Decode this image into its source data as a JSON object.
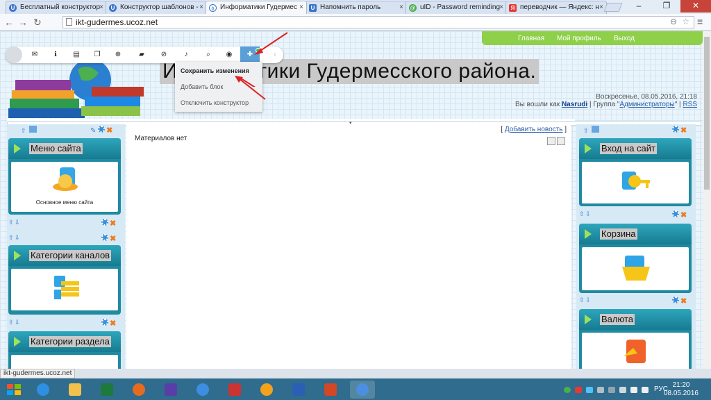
{
  "browser": {
    "tabs": [
      {
        "label": "Бесплатный конструктор"
      },
      {
        "label": "Конструктор шаблонов -"
      },
      {
        "label": "Информатики Гудермес"
      },
      {
        "label": "Напомнить пароль"
      },
      {
        "label": "uID - Password reminding"
      },
      {
        "label": "переводчик — Яндекс: н"
      }
    ],
    "url": "ikt-gudermes.ucoz.net"
  },
  "site": {
    "nav": {
      "home": "Главная",
      "profile": "Мой профиль",
      "logout": "Выход"
    },
    "title": "Информатики Гудермесского района.",
    "date": "Воскресенье, 08.05.2016, 21:18",
    "login_prefix": "Вы вошли как",
    "login_user": "Nasrudi",
    "group_prefix": "| Группа \"",
    "group": "Администраторы",
    "group_suffix": "\" |",
    "rss": "RSS"
  },
  "toolbar": {
    "menu": [
      "Сохранить изменения",
      "Добавить блок",
      "Отключить конструктор"
    ]
  },
  "left_blocks": [
    {
      "title": "Меню сайта",
      "caption": "Основное меню сайта"
    },
    {
      "title": "Категории каналов"
    },
    {
      "title": "Категории раздела"
    }
  ],
  "right_blocks": [
    {
      "title": "Вход на сайт"
    },
    {
      "title": "Корзина"
    },
    {
      "title": "Валюта"
    }
  ],
  "main": {
    "add_news_open": "[",
    "add_news": "Добавить новость",
    "add_news_close": "]",
    "empty": "Материалов нет"
  },
  "statusbar": "ikt-gudermes.ucoz.net",
  "taskbar": {
    "lang": "РУС",
    "time": "21:20",
    "date": "08.05.2016"
  },
  "colors": {
    "accent": "#1f8aa0",
    "nav_green": "#8ed04a",
    "taskbar": "#2f6c8e"
  }
}
